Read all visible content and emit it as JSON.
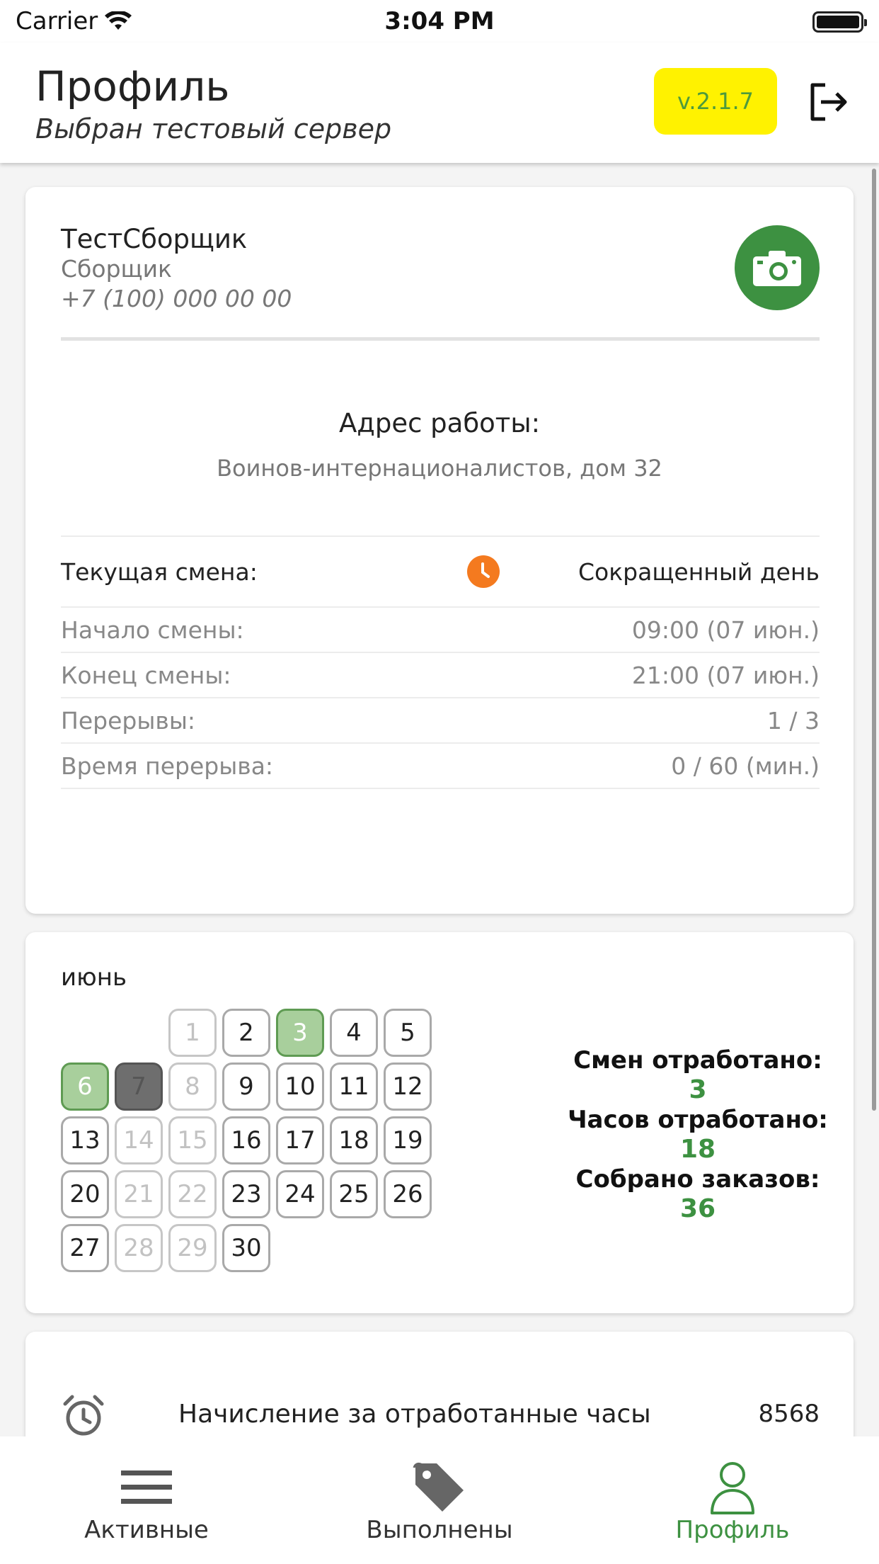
{
  "status_bar": {
    "carrier": "Carrier",
    "time": "3:04 PM"
  },
  "header": {
    "title": "Профиль",
    "subtitle": "Выбран тестовый сервер",
    "version": "v.2.1.7",
    "logout_icon": "logout-icon"
  },
  "profile": {
    "name": "ТестСборщик",
    "role": "Сборщик",
    "phone": "+7 (100) 000 00 00",
    "camera_icon": "camera-icon",
    "address_label": "Адрес работы:",
    "address_value": "Воинов-интернационалистов, дом 32"
  },
  "shift": {
    "label": "Текущая смена:",
    "value": "Сокращенный день",
    "icon": "clock-icon",
    "icon_color": "#f47a1f",
    "rows": [
      {
        "label": "Начало смены:",
        "value": "09:00 (07 июн.)"
      },
      {
        "label": "Конец смены:",
        "value": "21:00 (07 июн.)"
      },
      {
        "label": "Перерывы:",
        "value": "1 / 3"
      },
      {
        "label": "Время перерыва:",
        "value": "0 / 60 (мин.)"
      }
    ]
  },
  "calendar": {
    "month": "июнь",
    "days": [
      {
        "d": "1",
        "state": "muted"
      },
      {
        "d": "2",
        "state": "normal"
      },
      {
        "d": "3",
        "state": "green"
      },
      {
        "d": "4",
        "state": "normal"
      },
      {
        "d": "5",
        "state": "normal"
      },
      {
        "d": "6",
        "state": "green"
      },
      {
        "d": "7",
        "state": "gray"
      },
      {
        "d": "8",
        "state": "muted"
      },
      {
        "d": "9",
        "state": "normal"
      },
      {
        "d": "10",
        "state": "normal"
      },
      {
        "d": "11",
        "state": "normal"
      },
      {
        "d": "12",
        "state": "normal"
      },
      {
        "d": "13",
        "state": "normal"
      },
      {
        "d": "14",
        "state": "muted"
      },
      {
        "d": "15",
        "state": "muted"
      },
      {
        "d": "16",
        "state": "normal"
      },
      {
        "d": "17",
        "state": "normal"
      },
      {
        "d": "18",
        "state": "normal"
      },
      {
        "d": "19",
        "state": "normal"
      },
      {
        "d": "20",
        "state": "normal"
      },
      {
        "d": "21",
        "state": "muted"
      },
      {
        "d": "22",
        "state": "muted"
      },
      {
        "d": "23",
        "state": "normal"
      },
      {
        "d": "24",
        "state": "normal"
      },
      {
        "d": "25",
        "state": "normal"
      },
      {
        "d": "26",
        "state": "normal"
      },
      {
        "d": "27",
        "state": "normal"
      },
      {
        "d": "28",
        "state": "muted"
      },
      {
        "d": "29",
        "state": "muted"
      },
      {
        "d": "30",
        "state": "normal"
      }
    ],
    "first_weekday_index": 2
  },
  "stats": {
    "shifts_label": "Смен отработано:",
    "shifts_value": "3",
    "hours_label": "Часов отработано:",
    "hours_value": "18",
    "orders_label": "Собрано заказов:",
    "orders_value": "36",
    "accent": "#3d9141"
  },
  "accrual": {
    "icon": "alarm-clock-icon",
    "label": "Начисление за отработанные часы",
    "value": "8568"
  },
  "bottom_nav": {
    "items": [
      {
        "label": "Активные",
        "icon": "menu-lines-icon"
      },
      {
        "label": "Выполнены",
        "icon": "tag-icon"
      },
      {
        "label": "Профиль",
        "icon": "person-icon"
      }
    ],
    "active_index": 2,
    "active_color": "#3d9141"
  }
}
